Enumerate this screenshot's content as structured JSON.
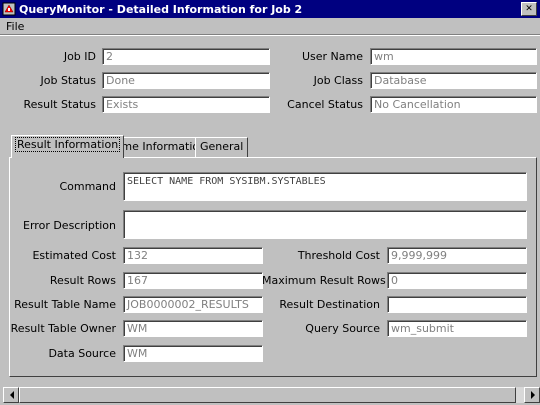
{
  "window": {
    "title": "QueryMonitor - Detailed Information for Job 2"
  },
  "menu": {
    "file": "File"
  },
  "header": {
    "job_id": {
      "label": "Job ID",
      "value": "2"
    },
    "user_name": {
      "label": "User Name",
      "value": "wm"
    },
    "job_status": {
      "label": "Job Status",
      "value": "Done"
    },
    "job_class": {
      "label": "Job Class",
      "value": "Database"
    },
    "result_status": {
      "label": "Result Status",
      "value": "Exists"
    },
    "cancel_status": {
      "label": "Cancel Status",
      "value": "No Cancellation"
    }
  },
  "tabs": [
    {
      "label": "Result Information",
      "active": true
    },
    {
      "label": "Time Information",
      "active": false
    },
    {
      "label": "General",
      "active": false
    }
  ],
  "result": {
    "command": {
      "label": "Command",
      "value": "SELECT NAME FROM SYSIBM.SYSTABLES"
    },
    "error_description": {
      "label": "Error Description",
      "value": ""
    },
    "estimated_cost": {
      "label": "Estimated Cost",
      "value": "132"
    },
    "threshold_cost": {
      "label": "Threshold Cost",
      "value": "9,999,999"
    },
    "result_rows": {
      "label": "Result Rows",
      "value": "167"
    },
    "max_result_rows": {
      "label": "Maximum Result Rows",
      "value": "0"
    },
    "result_table_name": {
      "label": "Result Table Name",
      "value": "JOB0000002_RESULTS"
    },
    "result_destination": {
      "label": "Result Destination",
      "value": ""
    },
    "result_table_owner": {
      "label": "Result Table Owner",
      "value": "WM"
    },
    "query_source": {
      "label": "Query Source",
      "value": "wm_submit"
    },
    "data_source": {
      "label": "Data Source",
      "value": "WM"
    }
  },
  "icons": {
    "app": "querymonitor-app-icon",
    "close": "close-icon",
    "scroll_left": "arrow-left-icon",
    "scroll_right": "arrow-right-icon"
  }
}
